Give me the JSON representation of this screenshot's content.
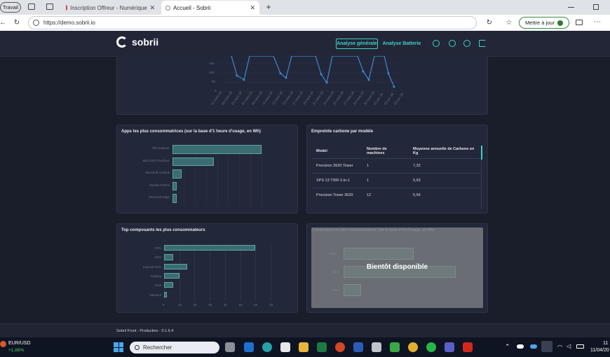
{
  "browser": {
    "tabs": [
      {
        "label": "Travail"
      },
      {
        "label": "Inscription Offreur - Numérique"
      },
      {
        "label": "Accueil - Sobrii"
      }
    ],
    "url": "https://demo.sobrii.io",
    "update_label": "Mettre à jour"
  },
  "app": {
    "brand": "sobrii",
    "nav": [
      "Analyse générale",
      "Analyse Batterie"
    ]
  },
  "top_chart": {
    "y_ticks": [
      "150",
      "100",
      "50",
      "0"
    ],
    "x_ticks": [
      "01 mars 26",
      "03 mars 26",
      "05 mars 26",
      "07 mars 26",
      "09 mars 26",
      "11 mars 26",
      "13 mars 26",
      "15 mars 26",
      "17 mars 26",
      "19 mars 26",
      "21 mars 26",
      "23 mars 26",
      "25 mars 26",
      "27 mars 26",
      "29 mars 26",
      "31 mars 26",
      "01 avr. 26",
      "03 avr. 26",
      "05 avr. 26"
    ]
  },
  "apps_card": {
    "title": "Apps les plus consommatrices (sur la base d'1 heure d'usage, en Wh)",
    "chart_data": {
      "type": "bar",
      "orientation": "horizontal",
      "categories": [
        "File Explorer",
        "Microsoft OneDrive",
        "Microsoft Outlook",
        "Mozilla Firefox",
        "Microsoft Edge"
      ],
      "values": [
        127,
        59,
        13,
        6,
        6
      ]
    }
  },
  "carbon_card": {
    "title": "Empreinte carbone par modèle",
    "columns": [
      "Model",
      "Nombre de machines",
      "Moyenne annuelle de Carbone en Kg"
    ],
    "rows": [
      [
        "Precision 3630 Tower",
        "1",
        "7,32"
      ],
      [
        "XPS 13 7390 2-in-1",
        "1",
        "5,63"
      ],
      [
        "Precision Tower 3620",
        "12",
        "5,54"
      ]
    ]
  },
  "components_card": {
    "title": "Top composants les plus consommateurs",
    "chart_data": {
      "type": "bar",
      "orientation": "horizontal",
      "categories": [
        "CPU",
        "GPU",
        "Internal GPU",
        "Display",
        "Disk",
        "Network"
      ],
      "values": [
        60,
        6,
        15,
        10,
        6,
        2
      ],
      "x_ticks": [
        "0",
        "10",
        "20",
        "30",
        "40",
        "50",
        "60",
        "70"
      ]
    }
  },
  "soon_card": {
    "title": "Composants les plus consommateurs (sur la base d'1h d'usage, en Wh)",
    "overlay": "Bientôt disponible",
    "labels": [
      "CPU",
      "Disk",
      "GPU"
    ]
  },
  "footer": "Sobrii Front - Production - 0.1.6.4",
  "taskbar": {
    "ticker": "EUR/USD",
    "ticker_change": "+1,88%",
    "search": "Rechercher",
    "time": "11",
    "date": "11/04/20"
  }
}
